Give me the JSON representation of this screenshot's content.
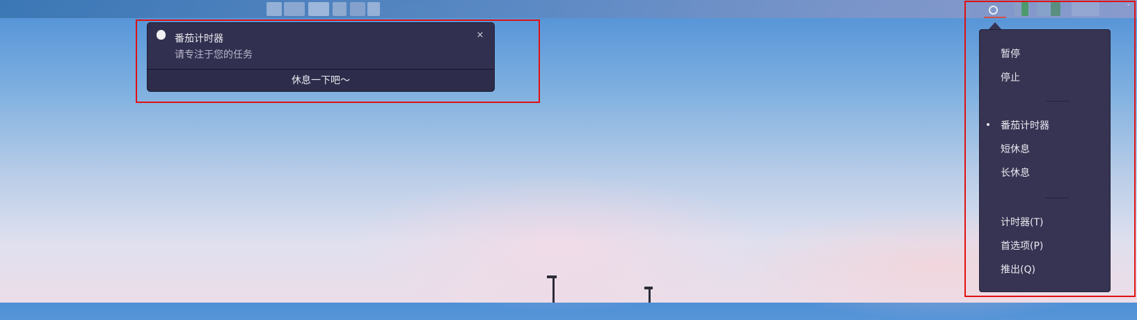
{
  "notification": {
    "title": "番茄计时器",
    "body": "请专注于您的任务",
    "close": "×",
    "action": "休息一下吧～",
    "icon": "tomato-timer-icon"
  },
  "tray": {
    "icon": "timer-ring-icon",
    "indicator_color": "#e24a3b",
    "corner_glyph": "˄"
  },
  "menu": {
    "pause": "暂停",
    "stop": "停止",
    "modes": [
      {
        "label": "番茄计时器",
        "selected": true
      },
      {
        "label": "短休息",
        "selected": false
      },
      {
        "label": "长休息",
        "selected": false
      }
    ],
    "timer": "计时器(T)",
    "preferences": "首选项(P)",
    "quit": "推出(Q)"
  },
  "colors": {
    "popup_bg": "#323050",
    "menu_bg": "#363452",
    "highlight_box": "#e01010"
  }
}
